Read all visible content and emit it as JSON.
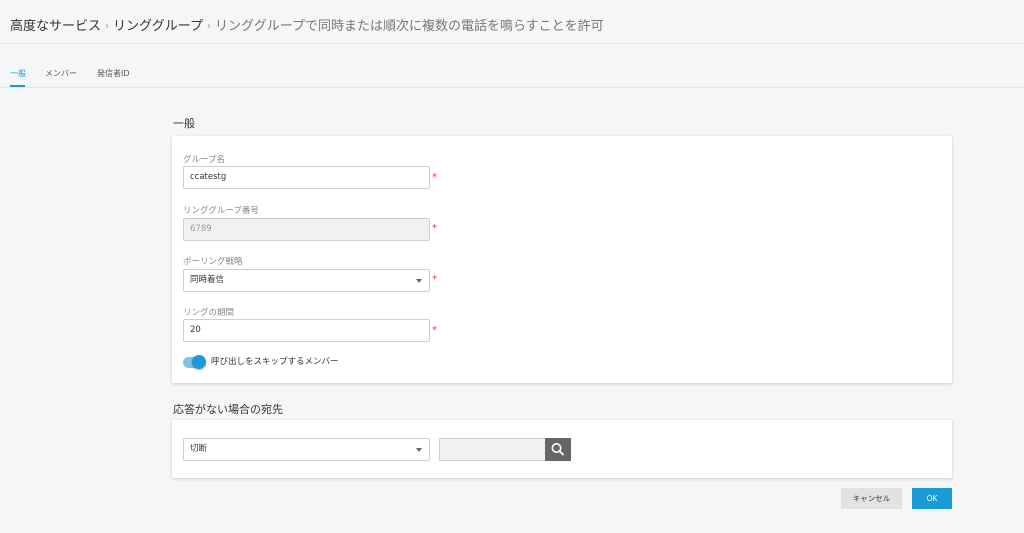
{
  "breadcrumb": {
    "items": [
      "高度なサービス",
      "リンググループ"
    ],
    "current": "リンググループで同時または順次に複数の電話を鳴らすことを許可",
    "separator": "›"
  },
  "tabs": [
    {
      "label": "一般",
      "active": true
    },
    {
      "label": "メンバー",
      "active": false
    },
    {
      "label": "発信者ID",
      "active": false
    }
  ],
  "general": {
    "title": "一般",
    "group_name": {
      "label": "グループ名",
      "value": "ccatestg"
    },
    "ring_group_number": {
      "label": "リンググループ番号",
      "placeholder": "6789"
    },
    "polling_strategy": {
      "label": "ポーリング戦略",
      "value": "同時着信"
    },
    "ring_duration": {
      "label": "リングの期間",
      "value": "20"
    },
    "skip_members": {
      "label": "呼び出しをスキップするメンバー",
      "enabled": true
    },
    "required_mark": "*"
  },
  "no_answer": {
    "title": "応答がない場合の宛先",
    "action": {
      "value": "切断"
    },
    "search": {
      "value": ""
    }
  },
  "buttons": {
    "cancel": "キャンセル",
    "ok": "OK"
  },
  "colors": {
    "accent": "#1a9ad6",
    "required": "#e0443a",
    "background": "#f5f6f8"
  },
  "icons": [
    "chevron-right-icon",
    "caret-down-icon",
    "search-icon"
  ]
}
